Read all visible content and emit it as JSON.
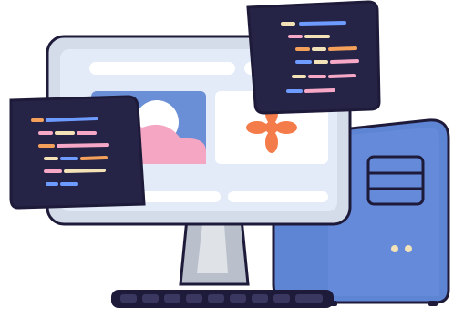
{
  "illustration": {
    "subject": "desktop-computer-with-code-windows",
    "colors": {
      "outline": "#1e1b3a",
      "monitor_bezel": "#d4dbe9",
      "screen_bg": "#e3eaf8",
      "screen_bar": "#ffffff",
      "image_card": "#6b8fd6",
      "image_cloud": "#f4a6c3",
      "image_sun": "#ffffff",
      "flower_card": "#ffffff",
      "flower": "#f47b4a",
      "stand": "#b9c0cc",
      "tower": "#5e84d4",
      "tower_side": "#4a6fbf",
      "code_window": "#262446",
      "code_blue": "#6e9bff",
      "code_pink": "#f6a8c6",
      "code_orange": "#f4a05a",
      "code_cream": "#f3e2b8"
    },
    "icons": [
      "image-icon",
      "flower-icon",
      "code-window-icon",
      "computer-tower-icon",
      "keyboard-icon"
    ]
  }
}
